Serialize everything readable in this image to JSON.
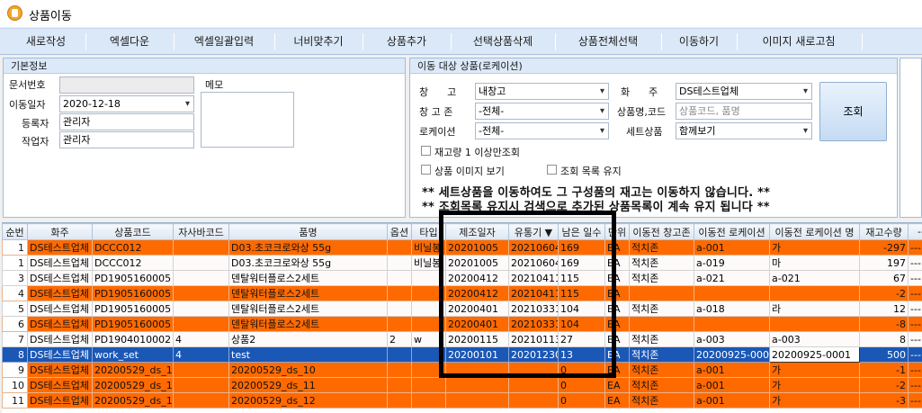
{
  "window": {
    "title": "상품이동",
    "icon": "app-logo-icon"
  },
  "toolbar": [
    "새로작성",
    "엑셀다운",
    "엑셀일괄입력",
    "너비맞추기",
    "상품추가",
    "선택상품삭제",
    "상품전체선택",
    "이동하기",
    "이미지 새로고침"
  ],
  "basic": {
    "header": "기본정보",
    "doc_no_label": "문서번호",
    "doc_no_value": "",
    "memo_label": "메모",
    "date_label": "이동일자",
    "date_value": "2020-12-18",
    "reg_label": "등록자",
    "reg_value": "관리자",
    "worker_label": "작업자",
    "worker_value": "관리자"
  },
  "target": {
    "header": "이동 대상 상품(로케이션)",
    "warehouse_label": "창      고",
    "warehouse_value": "내창고",
    "owner_label": "화      주",
    "owner_value": "DS테스트업체",
    "zone_label": "창 고 존",
    "zone_value": "-전체-",
    "product_label": "상품명,코드",
    "product_placeholder": "상품코드, 품명",
    "location_label": "로케이션",
    "location_value": "-전체-",
    "set_label": "세트상품",
    "set_value": "함께보기",
    "search_button": "조회",
    "chk_stock": "재고량 1 이상만조회",
    "chk_image": "상품 이미지 보기",
    "chk_keep": "조회 목록 유지",
    "notice1": "** 세트상품을 이동하여도 그 구성품의 재고는 이동하지 않습니다. **",
    "notice2": "** 조회목록 유지시 검색으로 추가된 상품목록이 계속 유지 됩니다 **"
  },
  "grid": {
    "columns": [
      "순번",
      "화주",
      "상품코드",
      "자사바코드",
      "품명",
      "옵션",
      "타입",
      "제조일자",
      "유통기 ▼",
      "남은 일수",
      "단위",
      "이동전 창고존",
      "이동전 로케이션",
      "이동전 로케이션 명",
      "재고수량",
      "---"
    ],
    "rows": [
      {
        "style": "orange",
        "cells": [
          "1",
          "DS테스트업체",
          "DCCC012",
          "",
          "D03.초코크로와상 55g",
          "",
          "비닐봉",
          "20201005",
          "20210604",
          "169",
          "EA",
          "적치존",
          "a-001",
          "가",
          "-297",
          "---"
        ]
      },
      {
        "style": "white",
        "cells": [
          "1",
          "DS테스트업체",
          "DCCC012",
          "",
          "D03.초코크로와상 55g",
          "",
          "비닐봉",
          "20201005",
          "20210604",
          "169",
          "EA",
          "적치존",
          "a-019",
          "마",
          "197",
          "---"
        ]
      },
      {
        "style": "white",
        "cells": [
          "3",
          "DS테스트업체",
          "PD1905160005",
          "",
          "덴탈워터플로스2세트",
          "",
          "",
          "20200412",
          "20210411",
          "115",
          "EA",
          "적치존",
          "a-021",
          "a-021",
          "67",
          "---"
        ]
      },
      {
        "style": "orange",
        "cells": [
          "4",
          "DS테스트업체",
          "PD1905160005",
          "",
          "덴탈워터플로스2세트",
          "",
          "",
          "20200412",
          "20210411",
          "115",
          "EA",
          "",
          "",
          "",
          "-2",
          "---"
        ]
      },
      {
        "style": "white",
        "cells": [
          "5",
          "DS테스트업체",
          "PD1905160005",
          "",
          "덴탈워터플로스2세트",
          "",
          "",
          "20200401",
          "20210331",
          "104",
          "EA",
          "적치존",
          "a-018",
          "라",
          "12",
          "---"
        ]
      },
      {
        "style": "orange",
        "cells": [
          "6",
          "DS테스트업체",
          "PD1905160005",
          "",
          "덴탈워터플로스2세트",
          "",
          "",
          "20200401",
          "20210331",
          "104",
          "EA",
          "",
          "",
          "",
          "-8",
          "---"
        ]
      },
      {
        "style": "white",
        "cells": [
          "7",
          "DS테스트업체",
          "PD1904010002",
          "4",
          "상품2",
          "2",
          "w",
          "20200115",
          "20210113",
          "27",
          "EA",
          "적치존",
          "a-003",
          "a-003",
          "8",
          "---"
        ]
      },
      {
        "style": "sel",
        "cells": [
          "8",
          "DS테스트업체",
          "work_set",
          "4",
          "test",
          "",
          "",
          "20200101",
          "20201230",
          "13",
          "EA",
          "적치존",
          "20200925-0001",
          "20200925-0001",
          "500",
          "---"
        ]
      },
      {
        "style": "orange",
        "cells": [
          "9",
          "DS테스트업체",
          "20200529_ds_10",
          "",
          "20200529_ds_10",
          "",
          "",
          "",
          "",
          "0",
          "EA",
          "적치존",
          "a-001",
          "가",
          "-1",
          "---"
        ]
      },
      {
        "style": "orange",
        "cells": [
          "10",
          "DS테스트업체",
          "20200529_ds_11",
          "",
          "20200529_ds_11",
          "",
          "",
          "",
          "",
          "0",
          "EA",
          "적치존",
          "a-001",
          "가",
          "-2",
          "---"
        ]
      },
      {
        "style": "orange",
        "cells": [
          "11",
          "DS테스트업체",
          "20200529_ds_12",
          "",
          "20200529_ds_12",
          "",
          "",
          "",
          "",
          "0",
          "EA",
          "적치존",
          "a-001",
          "가",
          "-3",
          "---"
        ]
      }
    ]
  },
  "colors": {
    "orange_row": "#ff6a00",
    "selected_row": "#1b57b5",
    "toolbar": "#dbe8f7"
  }
}
